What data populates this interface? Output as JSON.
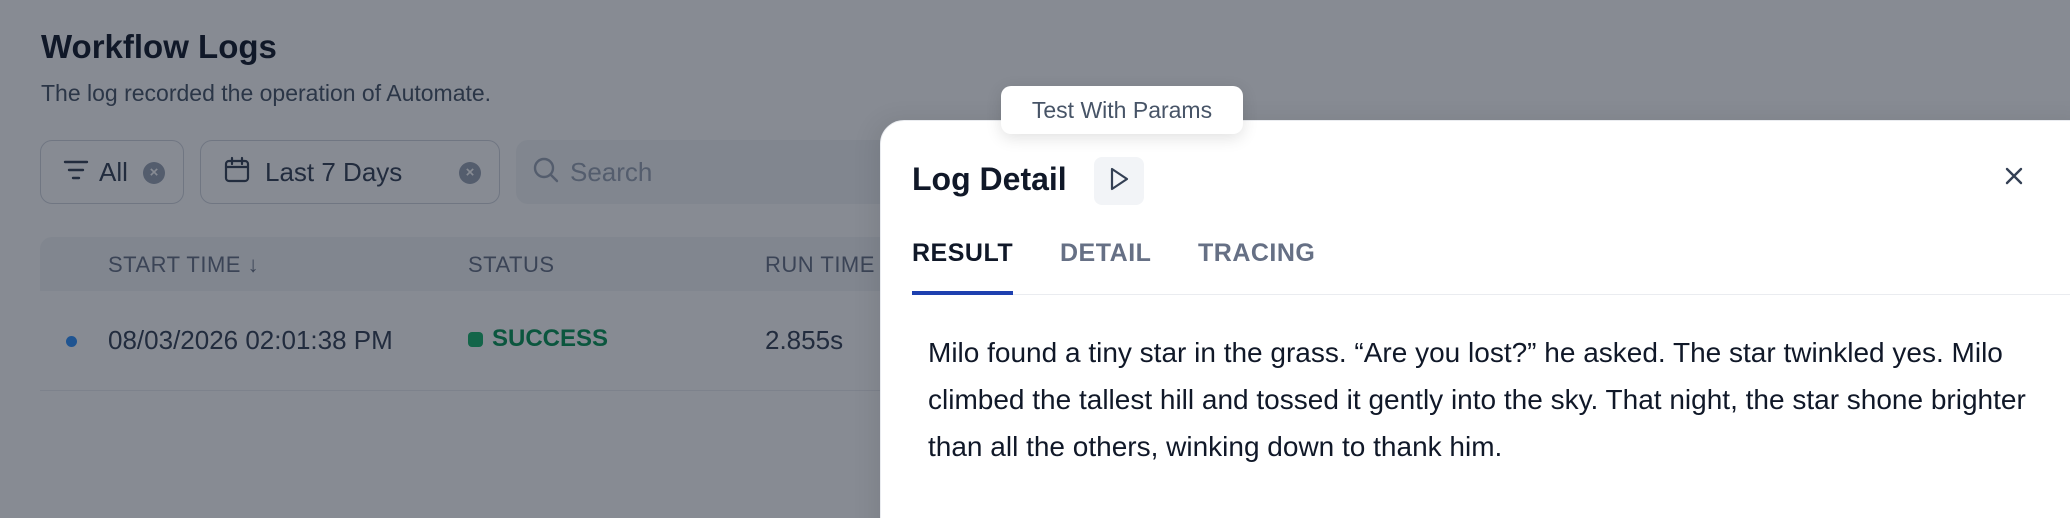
{
  "page": {
    "title": "Workflow Logs",
    "description": "The log recorded the operation of Automate."
  },
  "filters": {
    "status_value": "All",
    "date_range": "Last 7 Days",
    "search_placeholder": "Search"
  },
  "table": {
    "columns": [
      "START TIME ↓",
      "STATUS",
      "RUN TIME"
    ],
    "rows": [
      {
        "start_time": "08/03/2026 02:01:38 PM",
        "status": "SUCCESS",
        "run_time": "2.855s"
      }
    ]
  },
  "detail": {
    "title": "Log Detail",
    "tooltip": "Test With Params",
    "tabs": [
      "RESULT",
      "DETAIL",
      "TRACING"
    ],
    "active_tab": "RESULT",
    "result": "Milo found a tiny star in the grass. “Are you lost?” he asked. The star twinkled yes. Milo climbed the tallest hill and tossed it gently into the sky. That night, the star shone brighter than all the others, winking down to thank him."
  },
  "icons": {
    "filter": "filter-icon",
    "calendar": "calendar-icon",
    "search": "search-icon",
    "clear": "clear-icon",
    "play": "play-icon",
    "close": "close-icon"
  },
  "colors": {
    "success": "#079455",
    "active_tab": "#1e40af",
    "row_indicator": "#2e90fa"
  }
}
